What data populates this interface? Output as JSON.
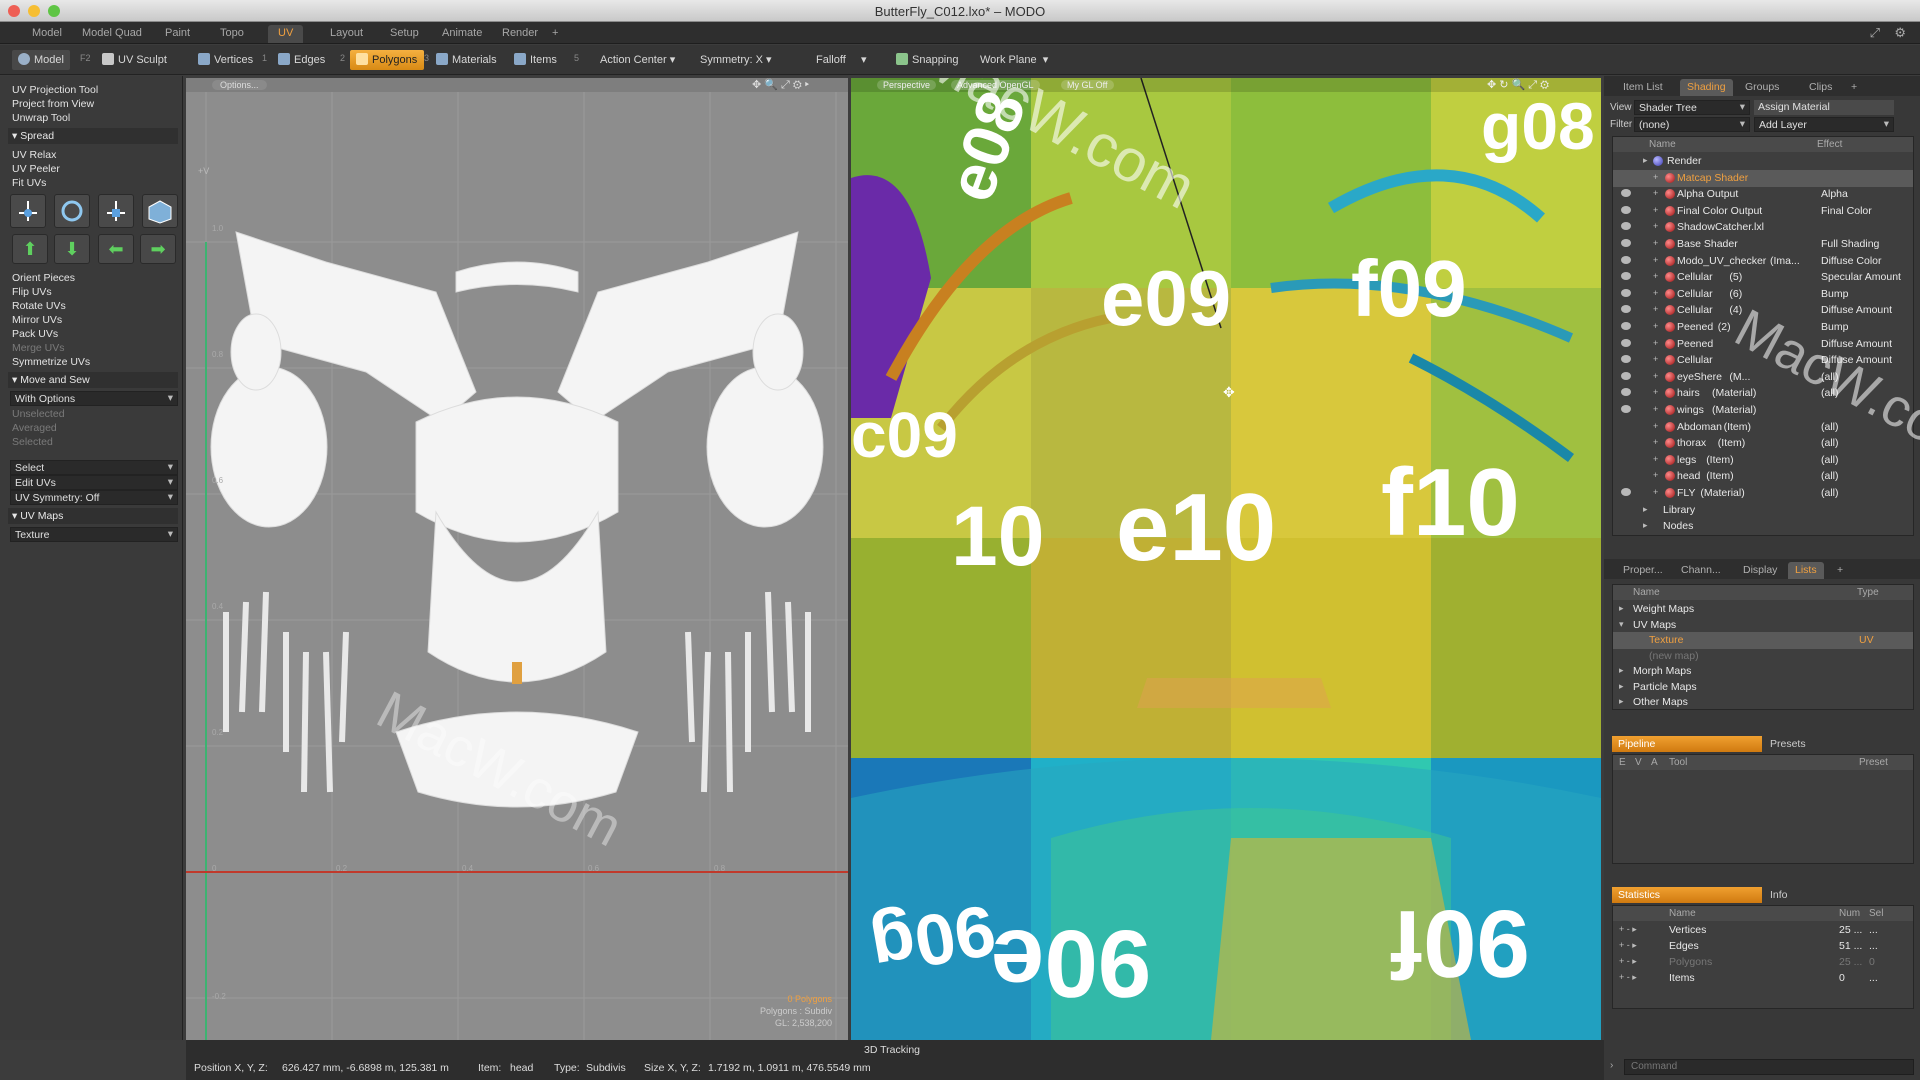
{
  "window": {
    "title": "ButterFly_C012.lxo* – MODO"
  },
  "layout_tabs": [
    "Model",
    "Model Quad",
    "Paint",
    "Topo",
    "UV",
    "Layout",
    "Setup",
    "Animate",
    "Render",
    "+"
  ],
  "toolbar": {
    "mode_model": "Model",
    "shortcut_f2": "F2",
    "uv_sculpt": "UV Sculpt",
    "vertices": "Vertices",
    "vertices_num": "1",
    "edges": "Edges",
    "edges_num": "2",
    "polygons": "Polygons",
    "polygons_num": "3",
    "materials": "Materials",
    "items": "Items",
    "items_num": "5",
    "action_center": "Action Center",
    "symmetry": "Symmetry: X",
    "falloff": "Falloff",
    "snapping": "Snapping",
    "work_plane": "Work Plane"
  },
  "left_panel": {
    "tools_top": [
      "UV Projection Tool",
      "Project from View",
      "Unwrap Tool"
    ],
    "spread_header": "Spread",
    "tools_spread": [
      "UV Relax",
      "UV Peeler",
      "Fit UVs"
    ],
    "tools_orient": [
      "Orient Pieces",
      "Flip UVs",
      "Rotate UVs",
      "Mirror UVs",
      "Pack UVs"
    ],
    "merge_uvs": "Merge UVs",
    "symmetrize_uvs": "Symmetrize UVs",
    "move_sew_header": "Move and Sew",
    "with_options": "With Options",
    "options_dim": [
      "Unselected",
      "Averaged",
      "Selected"
    ],
    "select_drop": "Select",
    "edit_uvs_drop": "Edit UVs",
    "uv_symmetry_drop": "UV Symmetry: Off",
    "uv_maps_header": "UV Maps",
    "texture_drop": "Texture"
  },
  "uv_view": {
    "options_btn": "Options...",
    "axis_v_label": "+V",
    "ticks_v": [
      "1.0",
      "0.8",
      "0.6",
      "0.4",
      "0.2",
      "0",
      "-0.2"
    ],
    "ticks_u": [
      "0.2",
      "0.4",
      "0.6",
      "0.8"
    ],
    "info_line1": "0 Polygons",
    "info_line2": "Polygons : Subdiv",
    "info_line3": "GL: 2,538,200"
  },
  "viewport3d": {
    "label_perspective": "Perspective",
    "label_advanced": "Advanced OpenGL",
    "label_gl": "My GL Off",
    "footer_label": "3D Tracking",
    "texture_labels": [
      "e09",
      "f09",
      "c09",
      "10",
      "e10",
      "f10",
      "90e",
      "90f",
      "90g",
      "e08",
      "g08"
    ]
  },
  "status": {
    "position_label": "Position X, Y, Z:",
    "position_value": "626.427 mm, -6.6898 m, 125.381 m",
    "item_label": "Item:",
    "item_value": "head",
    "type_label": "Type:",
    "type_value": "Subdivis",
    "size_label": "Size X, Y, Z:",
    "size_value": "1.7192 m, 1.0911 m, 476.5549 mm"
  },
  "right_top": {
    "tabs": [
      "Item List",
      "Shading",
      "Groups",
      "Clips",
      "+"
    ],
    "view_label": "View",
    "view_value": "Shader Tree",
    "assign_material": "Assign Material",
    "filter_label": "Filter",
    "filter_value": "(none)",
    "add_layer": "Add Layer",
    "col_name": "Name",
    "col_effect": "Effect",
    "rows": [
      {
        "name": "Render",
        "sub": "",
        "effect": "",
        "indent": 0
      },
      {
        "name": "Matcap Shader",
        "sub": "",
        "effect": "",
        "indent": 1
      },
      {
        "name": "Alpha Output",
        "sub": "",
        "effect": "Alpha",
        "indent": 1
      },
      {
        "name": "Final Color Output",
        "sub": "",
        "effect": "Final Color",
        "indent": 1
      },
      {
        "name": "ShadowCatcher.lxl",
        "sub": "",
        "effect": "",
        "indent": 1
      },
      {
        "name": "Base Shader",
        "sub": "",
        "effect": "Full Shading",
        "indent": 1
      },
      {
        "name": "Modo_UV_checker",
        "sub": "(Ima...",
        "effect": "Diffuse Color",
        "indent": 1
      },
      {
        "name": "Cellular",
        "sub": "(5)",
        "effect": "Specular Amount",
        "indent": 1
      },
      {
        "name": "Cellular",
        "sub": "(6)",
        "effect": "Bump",
        "indent": 1
      },
      {
        "name": "Cellular",
        "sub": "(4)",
        "effect": "Diffuse Amount",
        "indent": 1
      },
      {
        "name": "Peened",
        "sub": "(2)",
        "effect": "Bump",
        "indent": 1
      },
      {
        "name": "Peened",
        "sub": "",
        "effect": "Diffuse Amount",
        "indent": 1
      },
      {
        "name": "Cellular",
        "sub": "",
        "effect": "Diffuse Amount",
        "indent": 1
      },
      {
        "name": "eyeShere",
        "sub": "(M...",
        "effect": "(all)",
        "indent": 1
      },
      {
        "name": "hairs",
        "sub": "(Material)",
        "effect": "(all)",
        "indent": 1
      },
      {
        "name": "wings",
        "sub": "(Material)",
        "effect": "",
        "indent": 1
      },
      {
        "name": "Abdoman",
        "sub": "(Item)",
        "effect": "(all)",
        "indent": 1
      },
      {
        "name": "thorax",
        "sub": "(Item)",
        "effect": "(all)",
        "indent": 1
      },
      {
        "name": "legs",
        "sub": "(Item)",
        "effect": "(all)",
        "indent": 1
      },
      {
        "name": "head",
        "sub": "(Item)",
        "effect": "(all)",
        "indent": 1
      },
      {
        "name": "FLY",
        "sub": "(Material)",
        "effect": "(all)",
        "indent": 1
      },
      {
        "name": "Library",
        "sub": "",
        "effect": "",
        "indent": 0
      },
      {
        "name": "Nodes",
        "sub": "",
        "effect": "",
        "indent": 0
      }
    ]
  },
  "right_mid": {
    "tabs": [
      "Proper...",
      "Chann...",
      "Display",
      "Lists",
      "+"
    ],
    "col_name": "Name",
    "col_type": "Type",
    "rows": [
      {
        "name": "Weight Maps",
        "type": ""
      },
      {
        "name": "UV Maps",
        "type": ""
      },
      {
        "name": "Texture",
        "type": "UV"
      },
      {
        "name": "(new map)",
        "type": ""
      },
      {
        "name": "Morph Maps",
        "type": ""
      },
      {
        "name": "Particle Maps",
        "type": ""
      },
      {
        "name": "Other Maps",
        "type": ""
      }
    ]
  },
  "pipeline": {
    "tab_active": "Pipeline",
    "tab_other": "Presets",
    "cols": [
      "E",
      "V",
      "A",
      "Tool",
      "Preset"
    ]
  },
  "statistics": {
    "tab_active": "Statistics",
    "tab_other": "Info",
    "col_name": "Name",
    "col_num": "Num",
    "col_sel": "Sel",
    "rows": [
      {
        "name": "Vertices",
        "num": "25 ...",
        "sel": "..."
      },
      {
        "name": "Edges",
        "num": "51 ...",
        "sel": "..."
      },
      {
        "name": "Polygons",
        "num": "25 ...",
        "sel": "0"
      },
      {
        "name": "Items",
        "num": "0",
        "sel": "..."
      }
    ]
  },
  "command": {
    "placeholder": "Command"
  },
  "watermark": {
    "text": "MacW.com"
  },
  "colors": {
    "accent": "#f0a040",
    "uv_bg": "#8d8d8d",
    "uv_red_axis": "#c0392b",
    "uv_green_axis": "#3cb371"
  }
}
